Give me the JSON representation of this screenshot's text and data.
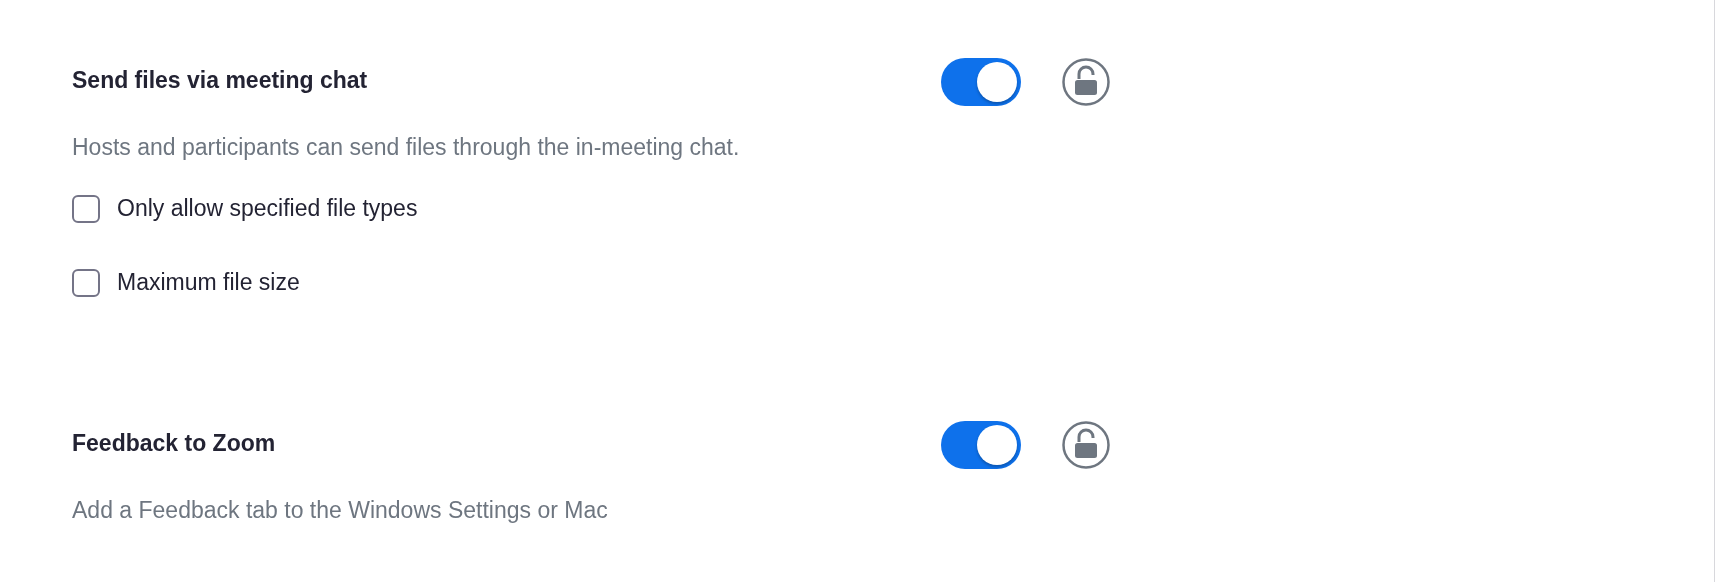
{
  "settings": [
    {
      "title": "Send files via meeting chat",
      "on": true,
      "locked": false,
      "description": "Hosts and participants can send files through the in-meeting chat.",
      "options": [
        {
          "label": "Only allow specified file types",
          "checked": false
        },
        {
          "label": "Maximum file size",
          "checked": false
        }
      ]
    },
    {
      "title": "Feedback to Zoom",
      "on": true,
      "locked": false,
      "description": "Add a Feedback tab to the Windows Settings or Mac"
    }
  ]
}
